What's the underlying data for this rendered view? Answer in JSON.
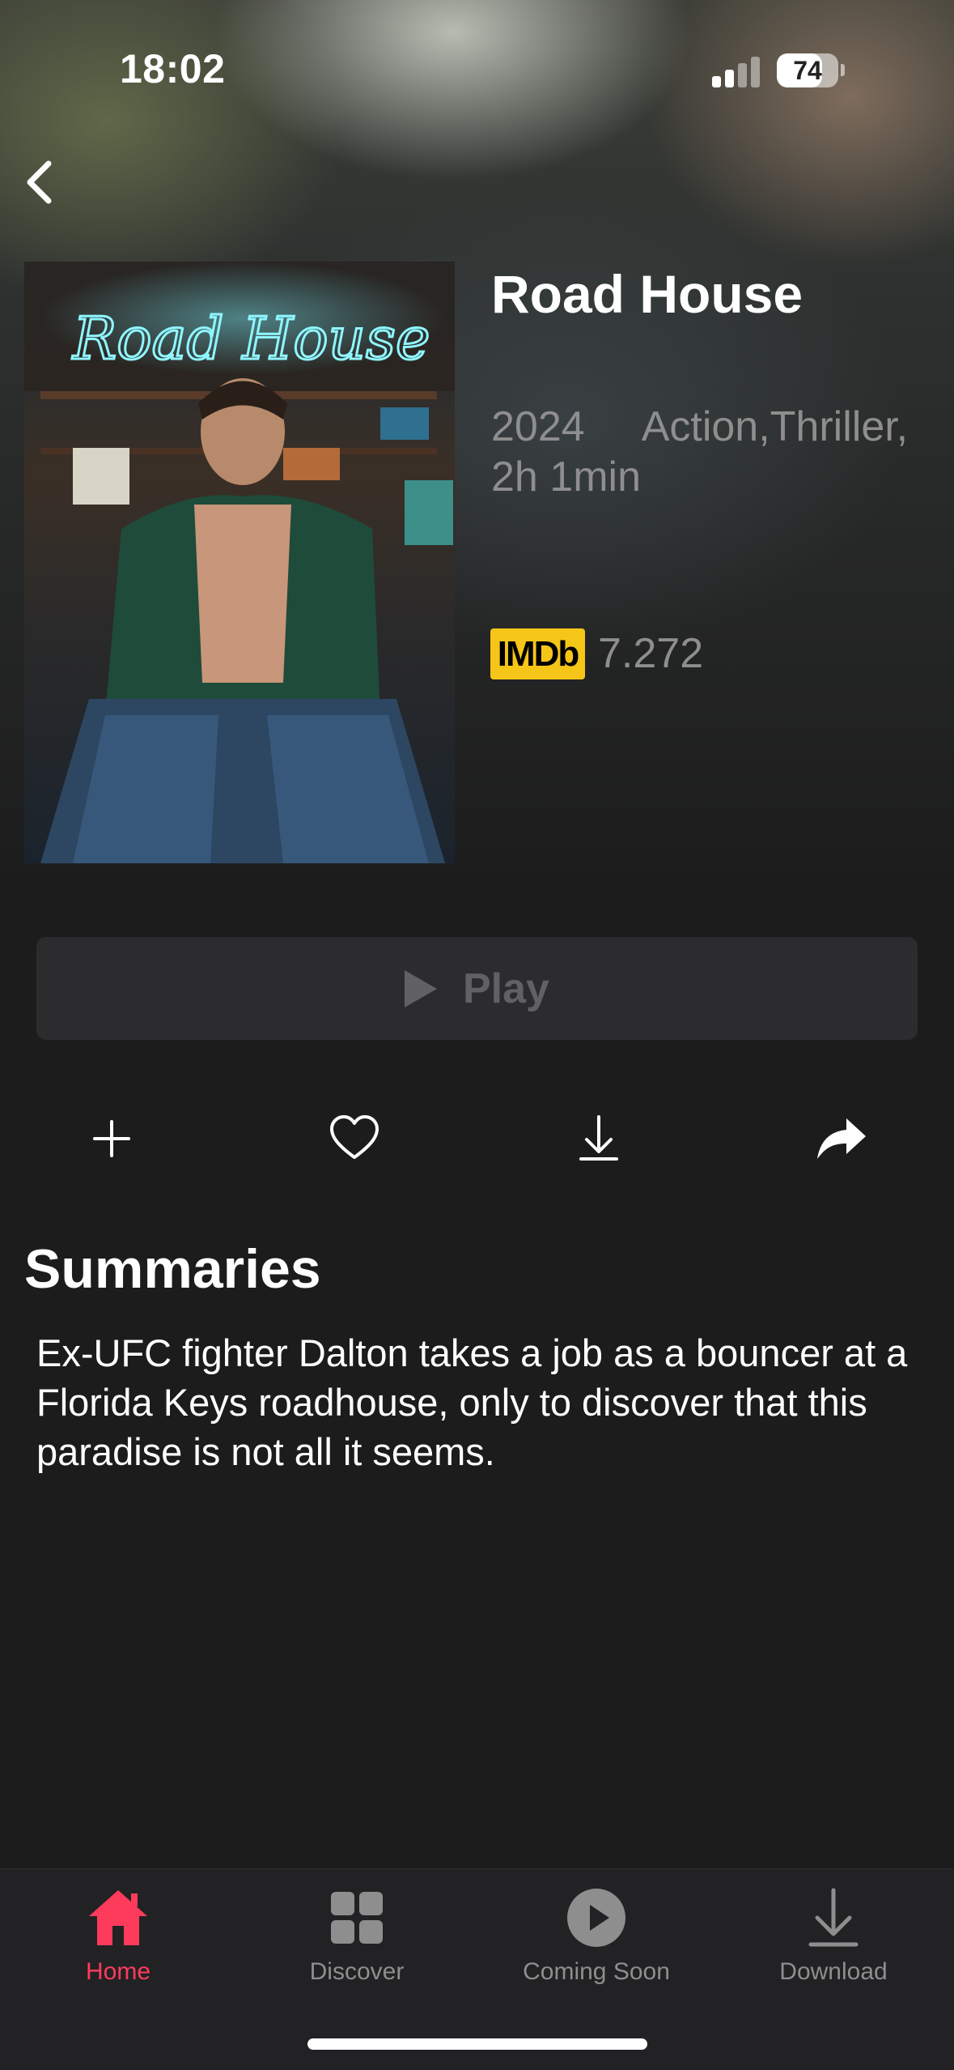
{
  "status_bar": {
    "time": "18:02",
    "battery_percent": "74",
    "battery_level": 0.74,
    "signal_bars_active": 2,
    "signal_bars_total": 4
  },
  "movie": {
    "title": "Road House",
    "year": "2024",
    "genres": "Action,Thriller,",
    "duration": "2h 1min",
    "imdb_label": "IMDb",
    "imdb_rating": "7.272",
    "poster_text": "Road House",
    "imdb_color": "#f5c518"
  },
  "play_button": {
    "label": "Play"
  },
  "actions": [
    {
      "name": "add",
      "icon": "plus-icon"
    },
    {
      "name": "favorite",
      "icon": "heart-icon"
    },
    {
      "name": "download",
      "icon": "download-icon"
    },
    {
      "name": "share",
      "icon": "share-icon"
    }
  ],
  "summary": {
    "heading": "Summaries",
    "text": "Ex-UFC fighter Dalton takes a job as a bouncer at a Florida Keys roadhouse, only to discover that this paradise is not all it seems."
  },
  "tabs": [
    {
      "label": "Home",
      "icon": "home-icon",
      "active": true
    },
    {
      "label": "Discover",
      "icon": "grid-icon",
      "active": false
    },
    {
      "label": "Coming Soon",
      "icon": "play-circle-icon",
      "active": false
    },
    {
      "label": "Download",
      "icon": "download-icon",
      "active": false
    }
  ],
  "colors": {
    "accent": "#ff3b5c",
    "background": "#1c1c1c",
    "button_bg": "#2c2c2e",
    "muted_text": "#8e8e8e"
  }
}
